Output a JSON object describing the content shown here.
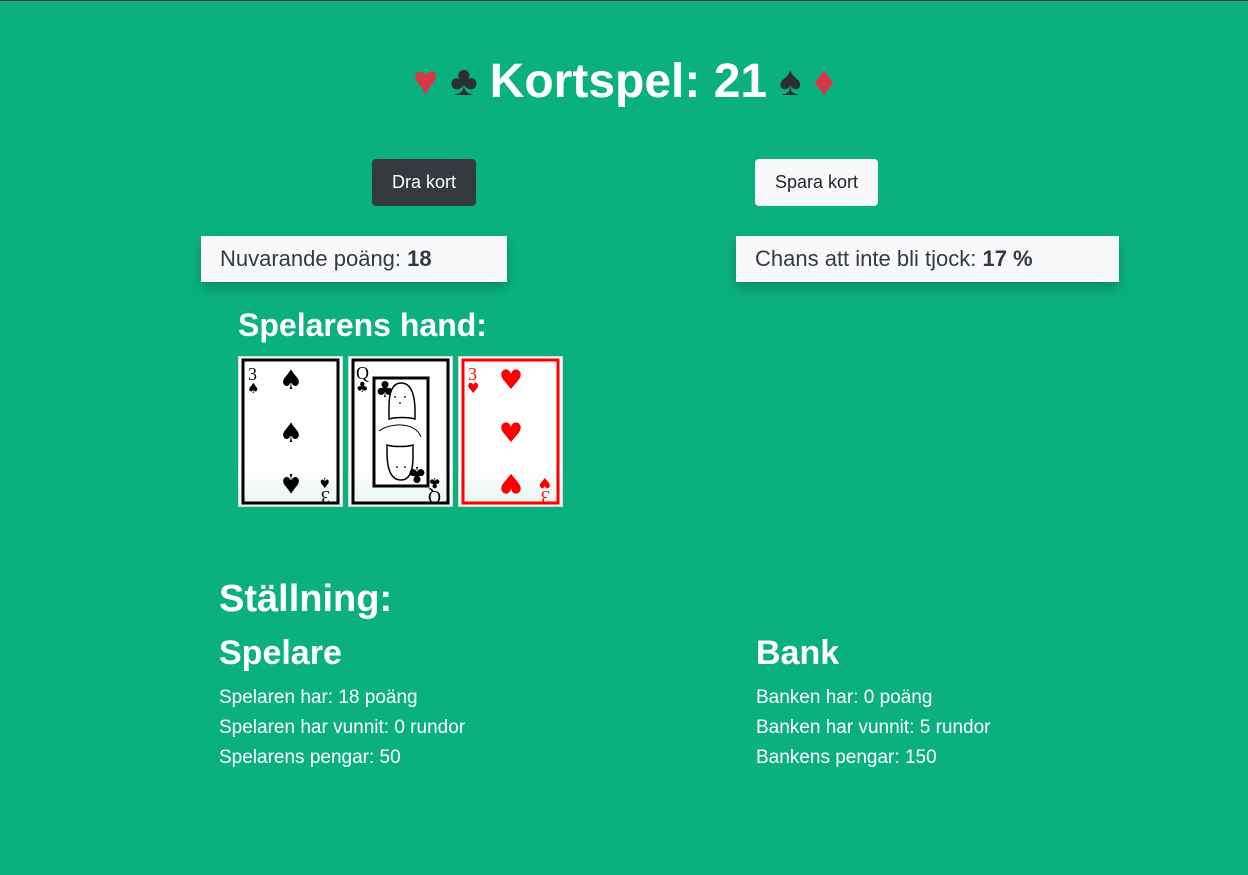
{
  "header": {
    "title": "Kortspel: 21",
    "suits_left": [
      "♥",
      "♣"
    ],
    "suits_right": [
      "♠",
      "♦"
    ]
  },
  "controls": {
    "draw_label": "Dra kort",
    "stand_label": "Spara kort"
  },
  "stats": {
    "points_label": "Nuvarande poäng: ",
    "points_value": "18",
    "chance_label": "Chans att inte bli tjock: ",
    "chance_value": "17 %"
  },
  "hand": {
    "title": "Spelarens hand:",
    "cards": [
      {
        "rank": "3",
        "suit": "♠",
        "color": "#000000"
      },
      {
        "rank": "Q",
        "suit": "♣",
        "color": "#000000"
      },
      {
        "rank": "3",
        "suit": "♥",
        "color": "#ff0000"
      }
    ]
  },
  "standings": {
    "title": "Ställning:",
    "player": {
      "title": "Spelare",
      "points": "Spelaren har: 18 poäng",
      "wins": "Spelaren har vunnit: 0 rundor",
      "money": "Spelarens pengar: 50"
    },
    "bank": {
      "title": "Bank",
      "points": "Banken har: 0 poäng",
      "wins": "Banken har vunnit: 5 rundor",
      "money": "Bankens pengar: 150"
    }
  },
  "colors": {
    "background": "#0ab17e",
    "red_suit": "#dc3545",
    "dark_suit": "#2c3035",
    "button_dark": "#343a40",
    "button_light": "#f8f9fa"
  }
}
